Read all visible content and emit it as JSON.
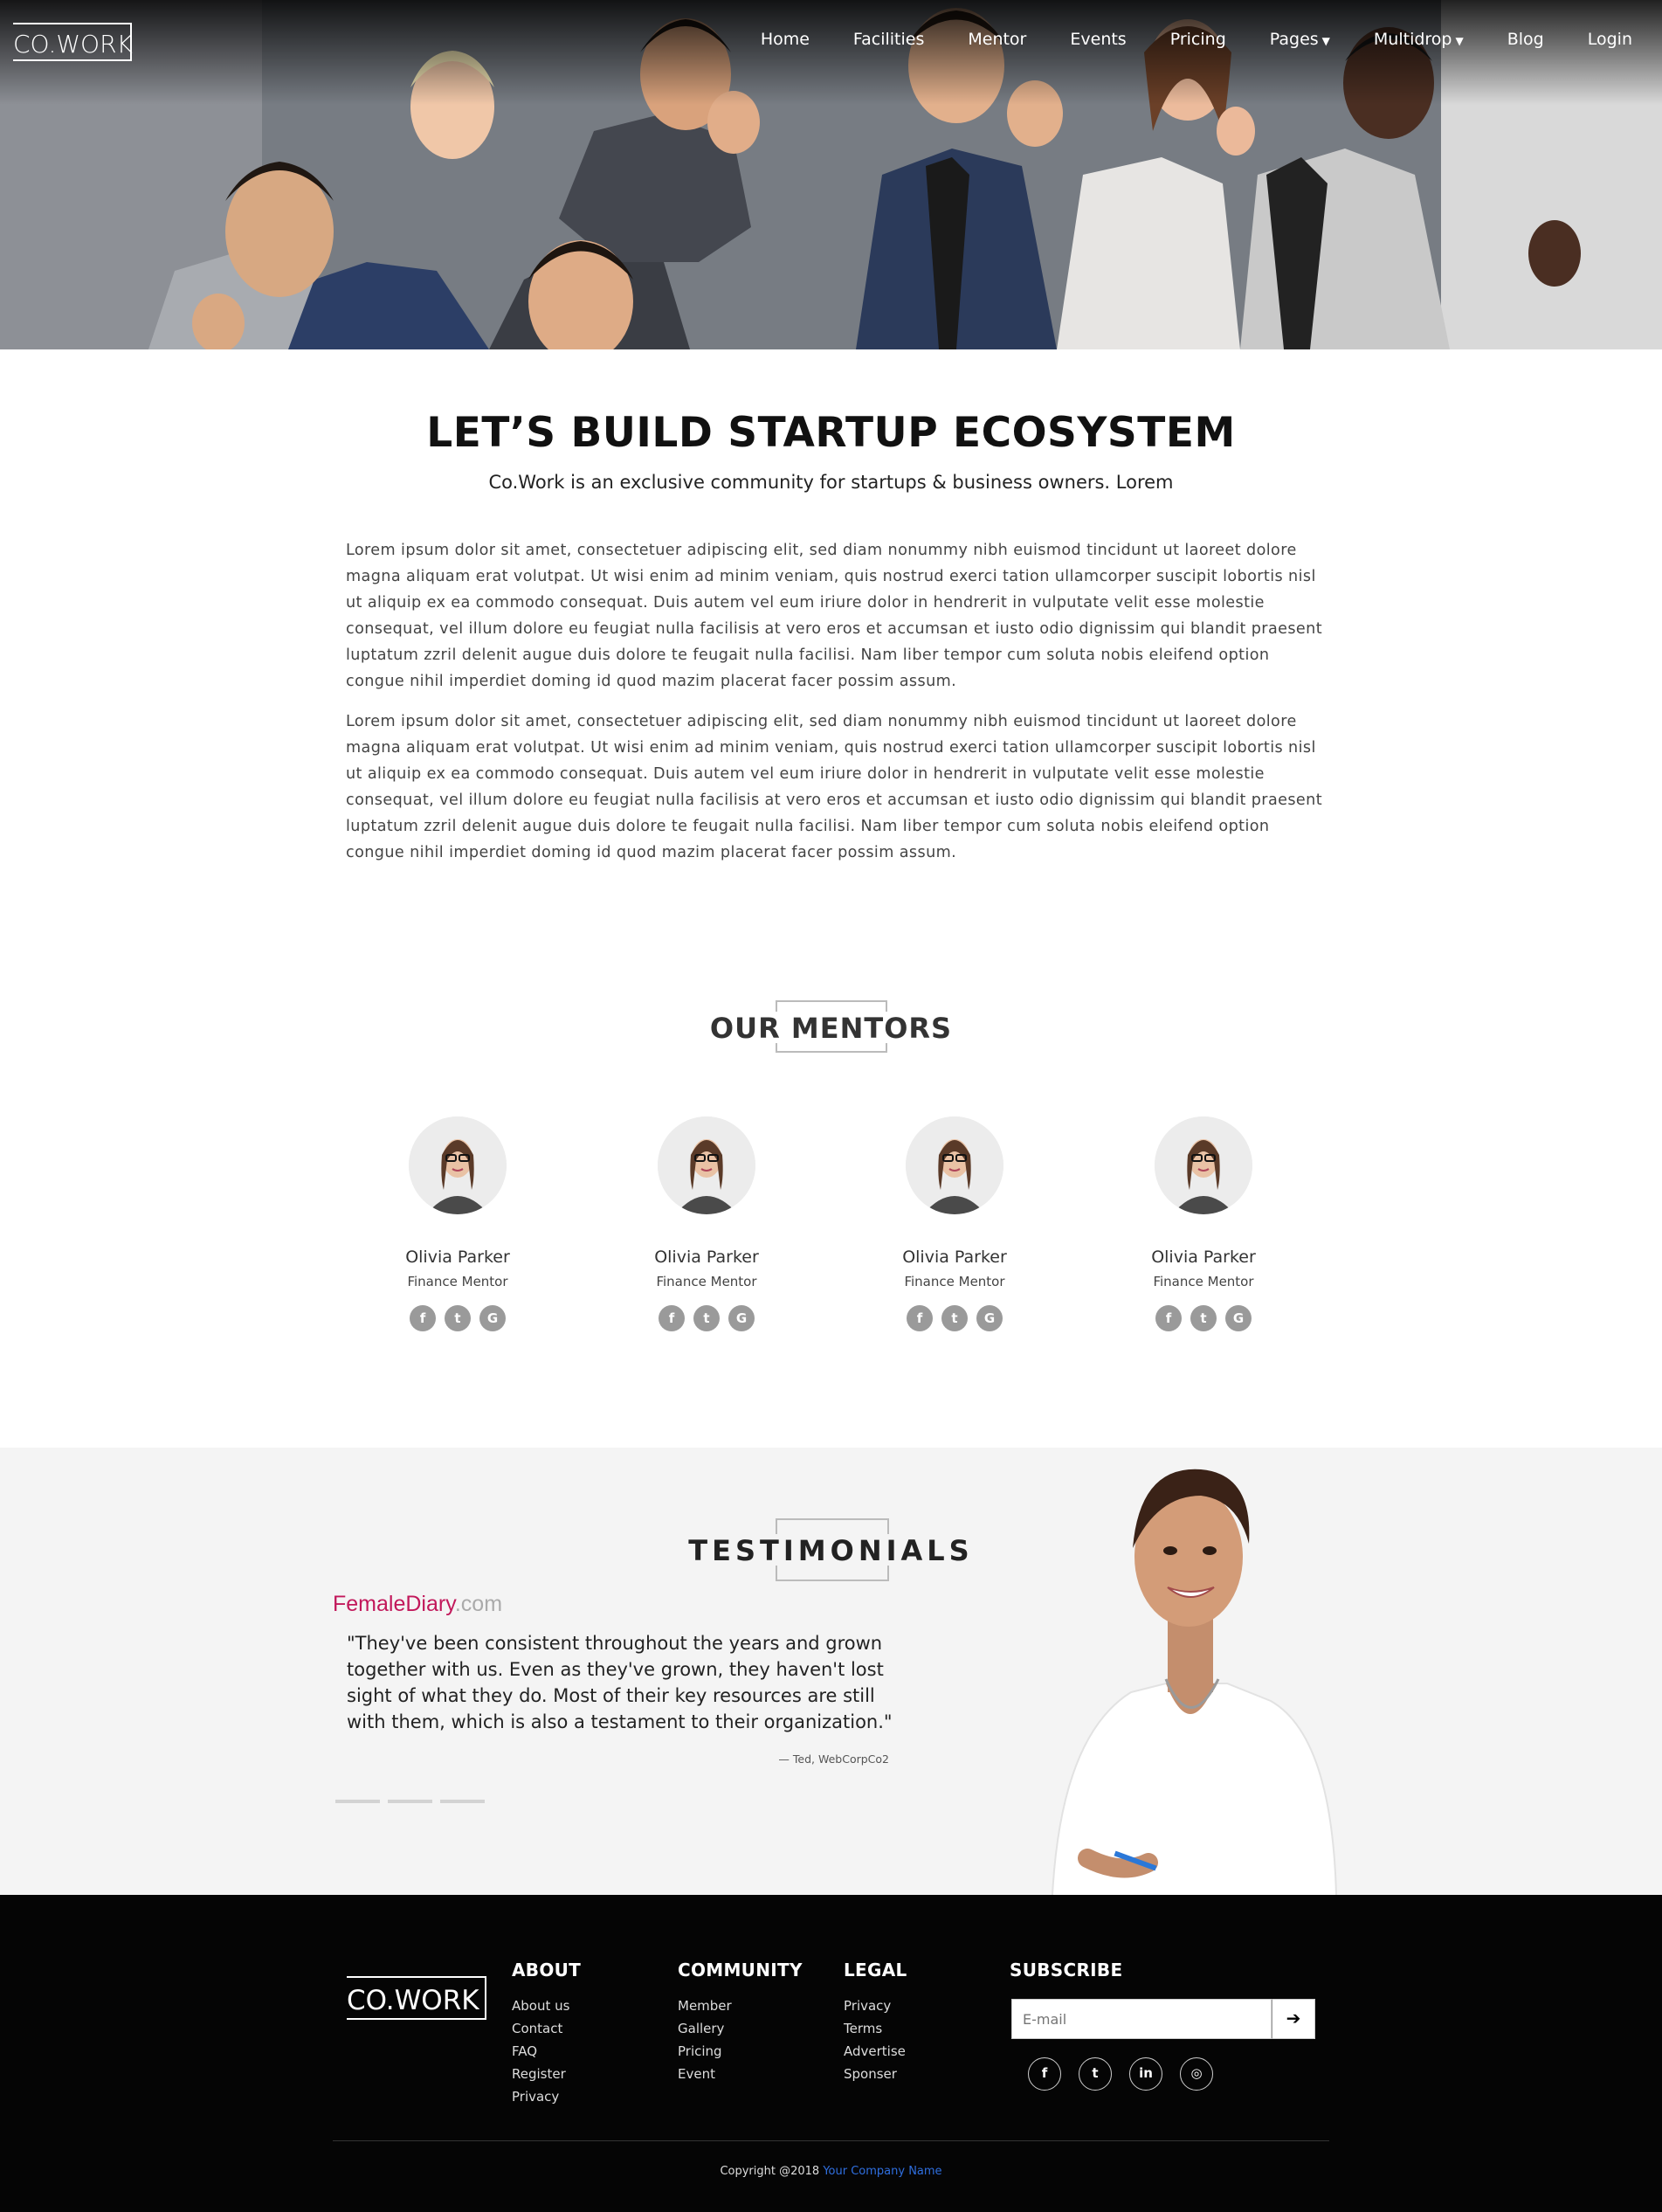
{
  "brand": {
    "logo_text": "CO.WORK"
  },
  "nav": {
    "items": [
      {
        "label": "Home"
      },
      {
        "label": "Facilities"
      },
      {
        "label": "Mentor"
      },
      {
        "label": "Events"
      },
      {
        "label": "Pricing"
      },
      {
        "label": "Pages",
        "has_caret": true
      },
      {
        "label": "Multidrop",
        "has_caret": true
      },
      {
        "label": "Blog"
      },
      {
        "label": "Login"
      }
    ]
  },
  "intro": {
    "title": "LET’S BUILD STARTUP ECOSYSTEM",
    "subtitle": "Co.Work is an exclusive community for startups & business owners. Lorem",
    "paragraphs": [
      "Lorem ipsum dolor sit amet, consectetuer adipiscing elit, sed diam nonummy nibh euismod tincidunt ut laoreet dolore magna aliquam erat volutpat. Ut wisi enim ad minim veniam, quis nostrud exerci tation ullamcorper suscipit lobortis nisl ut aliquip ex ea commodo consequat. Duis autem vel eum iriure dolor in hendrerit in vulputate velit esse molestie consequat, vel illum dolore eu feugiat nulla facilisis at vero eros et accumsan et iusto odio dignissim qui blandit praesent luptatum zzril delenit augue duis dolore te feugait nulla facilisi. Nam liber tempor cum soluta nobis eleifend option congue nihil imperdiet doming id quod mazim placerat facer possim assum.",
      "Lorem ipsum dolor sit amet, consectetuer adipiscing elit, sed diam nonummy nibh euismod tincidunt ut laoreet dolore magna aliquam erat volutpat. Ut wisi enim ad minim veniam, quis nostrud exerci tation ullamcorper suscipit lobortis nisl ut aliquip ex ea commodo consequat. Duis autem vel eum iriure dolor in hendrerit in vulputate velit esse molestie consequat, vel illum dolore eu feugiat nulla facilisis at vero eros et accumsan et iusto odio dignissim qui blandit praesent luptatum zzril delenit augue duis dolore te feugait nulla facilisi. Nam liber tempor cum soluta nobis eleifend option congue nihil imperdiet doming id quod mazim placerat facer possim assum."
    ]
  },
  "mentors": {
    "title": "OUR MENTORS",
    "items": [
      {
        "name": "Olivia Parker",
        "role": "Finance Mentor"
      },
      {
        "name": "Olivia Parker",
        "role": "Finance Mentor"
      },
      {
        "name": "Olivia Parker",
        "role": "Finance Mentor"
      },
      {
        "name": "Olivia Parker",
        "role": "Finance Mentor"
      }
    ],
    "social_icons": [
      "facebook-icon",
      "twitter-icon",
      "google-plus-icon"
    ]
  },
  "testimonials": {
    "title": "TESTIMONIALS",
    "brand_name": "FemaleDiary",
    "brand_suffix": ".com",
    "brand_color": "#c2185b",
    "quote": "\"They've been consistent throughout the years and grown together with us. Even as they've grown, they haven't lost sight of what they do. Most of their key resources are still with them, which is also a testament to their organization.\"",
    "author": "— Ted, WebCorpCo2",
    "slide_count": 3
  },
  "footer": {
    "logo_text": "CO.WORK",
    "columns": [
      {
        "title": "ABOUT",
        "links": [
          "About us",
          "Contact",
          "FAQ",
          "Register",
          "Privacy"
        ]
      },
      {
        "title": "COMMUNITY",
        "links": [
          "Member",
          "Gallery",
          "Pricing",
          "Event"
        ]
      },
      {
        "title": "LEGAL",
        "links": [
          "Privacy",
          "Terms",
          "Advertise",
          "Sponser"
        ]
      }
    ],
    "subscribe": {
      "title": "SUBSCRIBE",
      "placeholder": "E-mail",
      "button_icon": "arrow-right-icon"
    },
    "social_icons": [
      "facebook-icon",
      "twitter-icon",
      "linkedin-icon",
      "instagram-icon"
    ],
    "copyright_prefix": "Copyright @2018",
    "company_name": "Your Company Name",
    "link_color": "#2f6fe0"
  }
}
